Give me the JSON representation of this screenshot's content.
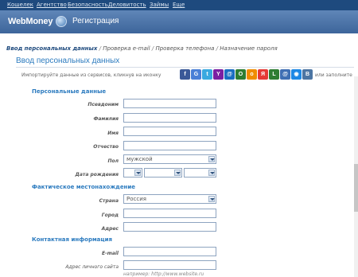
{
  "topnav": {
    "links": [
      "Кошелек",
      "Агентство",
      "Безопасность",
      "Деловитость",
      "Займы",
      "Еще"
    ]
  },
  "header": {
    "logo": "WebMoney",
    "title": "Регистрация"
  },
  "steps": {
    "current": "Ввод персональных данных",
    "rest": [
      "Проверка e-mail",
      "Проверка телефона",
      "Назначение пароля"
    ]
  },
  "page_title": "Ввод персональных данных",
  "import": {
    "prefix": "Импортируйте данные из сервисов, кликнув на иконку",
    "suffix": "или заполните"
  },
  "social_icons": [
    {
      "name": "facebook-icon",
      "glyph": "f",
      "color": "#3b5998"
    },
    {
      "name": "google-icon",
      "glyph": "G",
      "color": "#4a7fd6"
    },
    {
      "name": "twitter-icon",
      "glyph": "t",
      "color": "#39a9e0"
    },
    {
      "name": "yahoo-icon",
      "glyph": "Y",
      "color": "#7b1fa2"
    },
    {
      "name": "mail-icon",
      "glyph": "@",
      "color": "#1b6ec2"
    },
    {
      "name": "openid-icon",
      "glyph": "O",
      "color": "#2e7d32"
    },
    {
      "name": "odnoklassniki-icon",
      "glyph": "о",
      "color": "#f08c00"
    },
    {
      "name": "yandex-icon",
      "glyph": "Я",
      "color": "#e53935"
    },
    {
      "name": "liveinternet-icon",
      "glyph": "L",
      "color": "#2e7d32"
    },
    {
      "name": "rambler-icon",
      "glyph": "@",
      "color": "#3f6fb3"
    },
    {
      "name": "webmoney-icon",
      "glyph": "◉",
      "color": "#1e88e5"
    },
    {
      "name": "vkontakte-icon",
      "glyph": "B",
      "color": "#4c75a3"
    }
  ],
  "sections": {
    "personal": "Персональные данные",
    "location": "Фактическое местонахождение",
    "contact": "Контактная информация"
  },
  "labels": {
    "nickname": "Псевдоним",
    "surname": "Фамилия",
    "name": "Имя",
    "patronymic": "Отчество",
    "gender": "Пол",
    "birthdate": "Дата рождения",
    "country": "Страна",
    "city": "Город",
    "address": "Адрес",
    "email": "E-mail",
    "website": "Адрес личного сайта"
  },
  "values": {
    "gender": "мужской",
    "country": "Россия"
  },
  "website_hint": "например: http://www.website.ru"
}
